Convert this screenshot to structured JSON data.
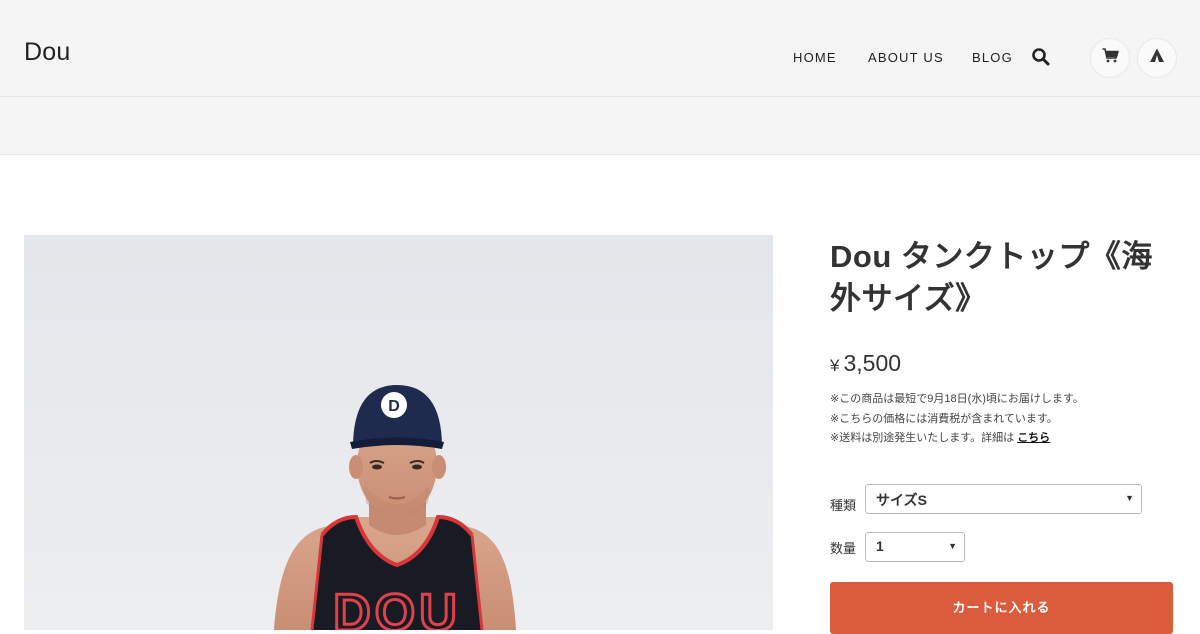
{
  "header": {
    "logo": "Dou",
    "nav": [
      {
        "label": "HOME"
      },
      {
        "label": "ABOUT US"
      },
      {
        "label": "BLOG"
      }
    ],
    "icons": [
      "search-icon",
      "cart-icon",
      "tent-icon"
    ]
  },
  "product": {
    "title": "Dou タンクトップ《海外サイズ》",
    "currency": "¥",
    "price": "3,500",
    "notes": [
      "※この商品は最短で9月18日(水)頃にお届けします。",
      "※こちらの価格には消費税が含まれています。",
      "※送料は別途発生いたします。詳細は"
    ],
    "shipping_link": "こちら",
    "options": {
      "variant_label": "種類",
      "variant_value": "サイズS",
      "quantity_label": "数量",
      "quantity_value": "1"
    },
    "add_to_cart": "カートに入れる",
    "photo": {
      "cap_logo": "D",
      "jersey_text": "DOU"
    }
  },
  "colors": {
    "accent": "#db5b3d",
    "header_bg": "#f5f5f5",
    "text": "#333333"
  }
}
